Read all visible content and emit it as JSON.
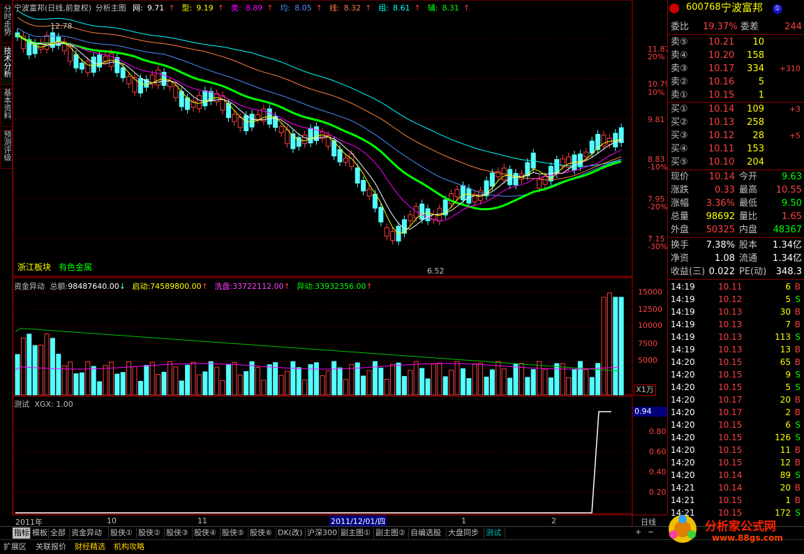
{
  "header": {
    "stock_title": "宁波富邦(日线,前复权)",
    "view_name": "分析主图",
    "indicators": [
      {
        "label": "网:",
        "value": "9.71",
        "color": "#ffffff"
      },
      {
        "label": "型:",
        "value": "9.19",
        "color": "#ffff00"
      },
      {
        "label": "类:",
        "value": "8.89",
        "color": "#ff00ff"
      },
      {
        "label": "均:",
        "value": "8.05",
        "color": "#4f8fff"
      },
      {
        "label": "线:",
        "value": "8.32",
        "color": "#ff8040"
      },
      {
        "label": "组:",
        "value": "8.61",
        "color": "#00ffff"
      },
      {
        "label": "辅:",
        "value": "8.31",
        "color": "#00ff00"
      }
    ]
  },
  "left_nav": [
    "分时走势",
    "技术分析",
    "基本资料",
    "预测评级"
  ],
  "main_chart": {
    "price_ticks": [
      "11.87",
      "10.79",
      "9.81",
      "8.83",
      "7.95",
      "7.15"
    ],
    "pct_ticks": [
      "20%",
      "10%",
      "-10%",
      "-20%",
      "-30%"
    ],
    "high_label": "12.78",
    "low_label": "6.52",
    "sector_label": "浙江板块",
    "sector_tag": "有色金属"
  },
  "volume_panel": {
    "title": "资金异动",
    "total_label": "总额:",
    "total_value": "98487640.00",
    "start_label": "启动:",
    "start_value": "74589800.00",
    "wash_label": "洗盘:",
    "wash_value": "33722112.00",
    "abnormal_label": "异动:",
    "abnormal_value": "33932356.00",
    "ticks": [
      "15000",
      "12500",
      "10000",
      "7500",
      "5000"
    ],
    "unit": "X1万"
  },
  "test_panel": {
    "title": "测试",
    "xgx_label": "XGX:",
    "xgx_value": "1.00",
    "ticks": [
      "0.80",
      "0.60",
      "0.40",
      "0.20"
    ],
    "current_value": "0.94"
  },
  "x_axis": {
    "labels": [
      "2011年",
      "10",
      "11",
      "2011/12/01/四",
      "1",
      "2"
    ],
    "period": "日线"
  },
  "quote": {
    "code": "600768",
    "name": "宁波富邦",
    "order_ratio_label": "委比",
    "order_ratio": "19.37%",
    "order_diff_label": "委差",
    "order_diff": "244",
    "asks": [
      {
        "label": "卖⑤",
        "price": "10.21",
        "vol": "10",
        "chg": ""
      },
      {
        "label": "卖④",
        "price": "10.20",
        "vol": "158",
        "chg": ""
      },
      {
        "label": "卖③",
        "price": "10.17",
        "vol": "334",
        "chg": "+310"
      },
      {
        "label": "卖②",
        "price": "10.16",
        "vol": "5",
        "chg": ""
      },
      {
        "label": "卖①",
        "price": "10.15",
        "vol": "1",
        "chg": ""
      }
    ],
    "bids": [
      {
        "label": "买①",
        "price": "10.14",
        "vol": "109",
        "chg": "+3"
      },
      {
        "label": "买②",
        "price": "10.13",
        "vol": "258",
        "chg": ""
      },
      {
        "label": "买③",
        "price": "10.12",
        "vol": "28",
        "chg": "+5"
      },
      {
        "label": "买④",
        "price": "10.11",
        "vol": "153",
        "chg": ""
      },
      {
        "label": "买⑤",
        "price": "10.10",
        "vol": "204",
        "chg": ""
      }
    ],
    "stats": [
      {
        "l1": "现价",
        "v1": "10.14",
        "c1": "#ff4040",
        "l2": "今开",
        "v2": "9.63",
        "c2": "#00ff00"
      },
      {
        "l1": "涨跌",
        "v1": "0.33",
        "c1": "#ff4040",
        "l2": "最高",
        "v2": "10.55",
        "c2": "#ff4040"
      },
      {
        "l1": "涨幅",
        "v1": "3.36%",
        "c1": "#ff4040",
        "l2": "最低",
        "v2": "9.50",
        "c2": "#00ff00"
      },
      {
        "l1": "总量",
        "v1": "98692",
        "c1": "#ffff00",
        "l2": "量比",
        "v2": "1.65",
        "c2": "#ff4040"
      },
      {
        "l1": "外盘",
        "v1": "50325",
        "c1": "#ff4040",
        "l2": "内盘",
        "v2": "48367",
        "c2": "#00ff00"
      }
    ],
    "fundamentals": [
      {
        "l1": "换手",
        "v1": "7.38%",
        "l2": "股本",
        "v2": "1.34亿"
      },
      {
        "l1": "净资",
        "v1": "1.08",
        "l2": "流通",
        "v2": "1.34亿"
      },
      {
        "l1": "收益(三)",
        "v1": "0.022",
        "l2": "PE(动)",
        "v2": "348.3"
      }
    ],
    "ticks": [
      {
        "t": "14:19",
        "p": "10.11",
        "v": "6",
        "d": "B"
      },
      {
        "t": "14:19",
        "p": "10.12",
        "v": "5",
        "d": "S"
      },
      {
        "t": "14:19",
        "p": "10.13",
        "v": "30",
        "d": "B"
      },
      {
        "t": "14:19",
        "p": "10.13",
        "v": "7",
        "d": "B"
      },
      {
        "t": "14:19",
        "p": "10.13",
        "v": "113",
        "d": "S"
      },
      {
        "t": "14:19",
        "p": "10.13",
        "v": "13",
        "d": "B"
      },
      {
        "t": "14:20",
        "p": "10.15",
        "v": "65",
        "d": "B"
      },
      {
        "t": "14:20",
        "p": "10.15",
        "v": "9",
        "d": "S"
      },
      {
        "t": "14:20",
        "p": "10.15",
        "v": "5",
        "d": "S"
      },
      {
        "t": "14:20",
        "p": "10.17",
        "v": "20",
        "d": "B"
      },
      {
        "t": "14:20",
        "p": "10.17",
        "v": "2",
        "d": "B"
      },
      {
        "t": "14:20",
        "p": "10.15",
        "v": "6",
        "d": "S"
      },
      {
        "t": "14:20",
        "p": "10.15",
        "v": "126",
        "d": "S"
      },
      {
        "t": "14:20",
        "p": "10.15",
        "v": "11",
        "d": "B"
      },
      {
        "t": "14:20",
        "p": "10.15",
        "v": "12",
        "d": "B"
      },
      {
        "t": "14:20",
        "p": "10.14",
        "v": "89",
        "d": "S"
      },
      {
        "t": "14:21",
        "p": "10.14",
        "v": "20",
        "d": "B"
      },
      {
        "t": "14:21",
        "p": "10.15",
        "v": "1",
        "d": "B"
      },
      {
        "t": "14:21",
        "p": "10.15",
        "v": "172",
        "d": "S"
      }
    ]
  },
  "bottom_tabs": [
    "指标",
    "模板",
    "全部",
    "资金异动",
    "股侠①",
    "股侠②",
    "股侠③",
    "股侠④",
    "股侠⑤",
    "股侠⑥",
    "DK(改)",
    "沪深300",
    "副主图①",
    "副主图②",
    "自编选股",
    "大盘同步",
    "测试"
  ],
  "status_tabs": [
    "扩展区",
    "关联报价",
    "财经精选",
    "机构攻略"
  ],
  "watermark": {
    "text": "分析家公式网",
    "url": "www.88gs.com"
  },
  "colors": {
    "up": "#ff4040",
    "down": "#54ffff",
    "grid": "#800000",
    "axis": "#b00000"
  }
}
